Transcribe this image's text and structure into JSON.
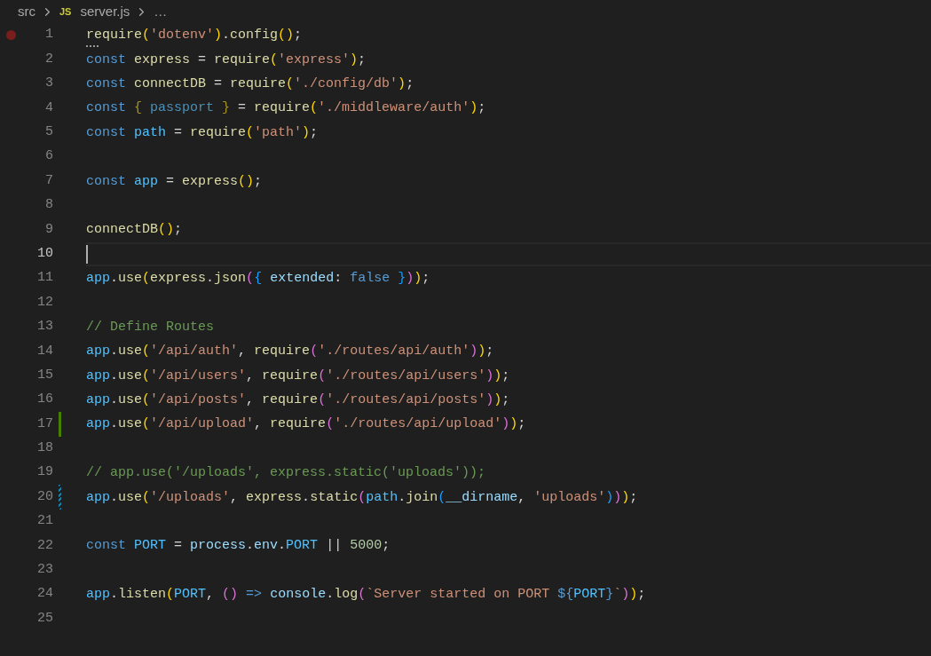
{
  "breadcrumb": [
    {
      "kind": "folder",
      "text": "src"
    },
    {
      "kind": "file",
      "text": "server.js",
      "icon_text": "JS"
    },
    {
      "kind": "more",
      "text": "…"
    }
  ],
  "lines": [
    {
      "number": "1",
      "breakpoint": true,
      "selected": false,
      "added": false,
      "modified": false,
      "hint": true,
      "tokens": [
        {
          "kind": "function",
          "text": "require"
        },
        {
          "kind": "bracket-outer",
          "text": "("
        },
        {
          "kind": "string",
          "text": "'dotenv'"
        },
        {
          "kind": "bracket-outer",
          "text": ")"
        },
        {
          "kind": "punctuation",
          "text": "."
        },
        {
          "kind": "function",
          "text": "config"
        },
        {
          "kind": "bracket-outer",
          "text": "()"
        },
        {
          "kind": "punctuation",
          "text": ";"
        }
      ]
    },
    {
      "number": "2",
      "breakpoint": false,
      "selected": false,
      "added": false,
      "modified": false,
      "hint": false,
      "tokens": [
        {
          "kind": "keyword",
          "text": "const "
        },
        {
          "kind": "function",
          "text": "express"
        },
        {
          "kind": "punctuation",
          "text": " = "
        },
        {
          "kind": "function",
          "text": "require"
        },
        {
          "kind": "bracket-outer",
          "text": "("
        },
        {
          "kind": "string",
          "text": "'express'"
        },
        {
          "kind": "bracket-outer",
          "text": ")"
        },
        {
          "kind": "punctuation",
          "text": ";"
        }
      ]
    },
    {
      "number": "3",
      "breakpoint": false,
      "selected": false,
      "added": false,
      "modified": false,
      "hint": false,
      "tokens": [
        {
          "kind": "keyword",
          "text": "const "
        },
        {
          "kind": "function",
          "text": "connectDB"
        },
        {
          "kind": "punctuation",
          "text": " = "
        },
        {
          "kind": "function",
          "text": "require"
        },
        {
          "kind": "bracket-outer",
          "text": "("
        },
        {
          "kind": "string",
          "text": "'./config/db'"
        },
        {
          "kind": "bracket-outer",
          "text": ")"
        },
        {
          "kind": "punctuation",
          "text": ";"
        }
      ]
    },
    {
      "number": "4",
      "breakpoint": false,
      "selected": false,
      "added": false,
      "modified": false,
      "hint": false,
      "tokens": [
        {
          "kind": "keyword",
          "text": "const "
        },
        {
          "kind": "unused-bracket",
          "text": "{ "
        },
        {
          "kind": "unused",
          "text": "passport "
        },
        {
          "kind": "unused-bracket",
          "text": "}"
        },
        {
          "kind": "punctuation",
          "text": " = "
        },
        {
          "kind": "function",
          "text": "require"
        },
        {
          "kind": "bracket-outer",
          "text": "("
        },
        {
          "kind": "string",
          "text": "'./middleware/auth'"
        },
        {
          "kind": "bracket-outer",
          "text": ")"
        },
        {
          "kind": "punctuation",
          "text": ";"
        }
      ]
    },
    {
      "number": "5",
      "breakpoint": false,
      "selected": false,
      "added": false,
      "modified": false,
      "hint": false,
      "tokens": [
        {
          "kind": "keyword",
          "text": "const "
        },
        {
          "kind": "constant",
          "text": "path"
        },
        {
          "kind": "punctuation",
          "text": " = "
        },
        {
          "kind": "function",
          "text": "require"
        },
        {
          "kind": "bracket-outer",
          "text": "("
        },
        {
          "kind": "string",
          "text": "'path'"
        },
        {
          "kind": "bracket-outer",
          "text": ")"
        },
        {
          "kind": "punctuation",
          "text": ";"
        }
      ]
    },
    {
      "number": "6",
      "breakpoint": false,
      "selected": false,
      "added": false,
      "modified": false,
      "hint": false
    },
    {
      "number": "7",
      "breakpoint": false,
      "selected": false,
      "added": false,
      "modified": false,
      "hint": false,
      "tokens": [
        {
          "kind": "keyword",
          "text": "const "
        },
        {
          "kind": "constant",
          "text": "app"
        },
        {
          "kind": "punctuation",
          "text": " = "
        },
        {
          "kind": "function",
          "text": "express"
        },
        {
          "kind": "bracket-outer",
          "text": "()"
        },
        {
          "kind": "punctuation",
          "text": ";"
        }
      ]
    },
    {
      "number": "8",
      "breakpoint": false,
      "selected": false,
      "added": false,
      "modified": false,
      "hint": false
    },
    {
      "number": "9",
      "breakpoint": false,
      "selected": false,
      "added": false,
      "modified": false,
      "hint": false,
      "tokens": [
        {
          "kind": "function",
          "text": "connectDB"
        },
        {
          "kind": "bracket-outer",
          "text": "()"
        },
        {
          "kind": "punctuation",
          "text": ";"
        }
      ]
    },
    {
      "number": "10",
      "breakpoint": false,
      "selected": true,
      "added": false,
      "modified": false,
      "hint": false
    },
    {
      "number": "11",
      "breakpoint": false,
      "selected": false,
      "added": false,
      "modified": false,
      "hint": false,
      "tokens": [
        {
          "kind": "constant",
          "text": "app"
        },
        {
          "kind": "punctuation",
          "text": "."
        },
        {
          "kind": "function",
          "text": "use"
        },
        {
          "kind": "bracket-outer",
          "text": "("
        },
        {
          "kind": "function",
          "text": "express"
        },
        {
          "kind": "punctuation",
          "text": "."
        },
        {
          "kind": "function",
          "text": "json"
        },
        {
          "kind": "bracket-middle",
          "text": "("
        },
        {
          "kind": "bracket-inner",
          "text": "{ "
        },
        {
          "kind": "variable",
          "text": "extended"
        },
        {
          "kind": "punctuation",
          "text": ": "
        },
        {
          "kind": "keyword",
          "text": "false "
        },
        {
          "kind": "bracket-inner",
          "text": "}"
        },
        {
          "kind": "bracket-middle",
          "text": ")"
        },
        {
          "kind": "bracket-outer",
          "text": ")"
        },
        {
          "kind": "punctuation",
          "text": ";"
        }
      ]
    },
    {
      "number": "12",
      "breakpoint": false,
      "selected": false,
      "added": false,
      "modified": false,
      "hint": false
    },
    {
      "number": "13",
      "breakpoint": false,
      "selected": false,
      "added": false,
      "modified": false,
      "hint": false,
      "tokens": [
        {
          "kind": "comment",
          "text": "// Define Routes"
        }
      ]
    },
    {
      "number": "14",
      "breakpoint": false,
      "selected": false,
      "added": false,
      "modified": false,
      "hint": false,
      "tokens": [
        {
          "kind": "constant",
          "text": "app"
        },
        {
          "kind": "punctuation",
          "text": "."
        },
        {
          "kind": "function",
          "text": "use"
        },
        {
          "kind": "bracket-outer",
          "text": "("
        },
        {
          "kind": "string",
          "text": "'/api/auth'"
        },
        {
          "kind": "punctuation",
          "text": ", "
        },
        {
          "kind": "function",
          "text": "require"
        },
        {
          "kind": "bracket-middle",
          "text": "("
        },
        {
          "kind": "string",
          "text": "'./routes/api/auth'"
        },
        {
          "kind": "bracket-middle",
          "text": ")"
        },
        {
          "kind": "bracket-outer",
          "text": ")"
        },
        {
          "kind": "punctuation",
          "text": ";"
        }
      ]
    },
    {
      "number": "15",
      "breakpoint": false,
      "selected": false,
      "added": false,
      "modified": false,
      "hint": false,
      "tokens": [
        {
          "kind": "constant",
          "text": "app"
        },
        {
          "kind": "punctuation",
          "text": "."
        },
        {
          "kind": "function",
          "text": "use"
        },
        {
          "kind": "bracket-outer",
          "text": "("
        },
        {
          "kind": "string",
          "text": "'/api/users'"
        },
        {
          "kind": "punctuation",
          "text": ", "
        },
        {
          "kind": "function",
          "text": "require"
        },
        {
          "kind": "bracket-middle",
          "text": "("
        },
        {
          "kind": "string",
          "text": "'./routes/api/users'"
        },
        {
          "kind": "bracket-middle",
          "text": ")"
        },
        {
          "kind": "bracket-outer",
          "text": ")"
        },
        {
          "kind": "punctuation",
          "text": ";"
        }
      ]
    },
    {
      "number": "16",
      "breakpoint": false,
      "selected": false,
      "added": false,
      "modified": false,
      "hint": false,
      "tokens": [
        {
          "kind": "constant",
          "text": "app"
        },
        {
          "kind": "punctuation",
          "text": "."
        },
        {
          "kind": "function",
          "text": "use"
        },
        {
          "kind": "bracket-outer",
          "text": "("
        },
        {
          "kind": "string",
          "text": "'/api/posts'"
        },
        {
          "kind": "punctuation",
          "text": ", "
        },
        {
          "kind": "function",
          "text": "require"
        },
        {
          "kind": "bracket-middle",
          "text": "("
        },
        {
          "kind": "string",
          "text": "'./routes/api/posts'"
        },
        {
          "kind": "bracket-middle",
          "text": ")"
        },
        {
          "kind": "bracket-outer",
          "text": ")"
        },
        {
          "kind": "punctuation",
          "text": ";"
        }
      ]
    },
    {
      "number": "17",
      "breakpoint": false,
      "selected": false,
      "added": true,
      "modified": false,
      "hint": false,
      "tokens": [
        {
          "kind": "constant",
          "text": "app"
        },
        {
          "kind": "punctuation",
          "text": "."
        },
        {
          "kind": "function",
          "text": "use"
        },
        {
          "kind": "bracket-outer",
          "text": "("
        },
        {
          "kind": "string",
          "text": "'/api/upload'"
        },
        {
          "kind": "punctuation",
          "text": ", "
        },
        {
          "kind": "function",
          "text": "require"
        },
        {
          "kind": "bracket-middle",
          "text": "("
        },
        {
          "kind": "string",
          "text": "'./routes/api/upload'"
        },
        {
          "kind": "bracket-middle",
          "text": ")"
        },
        {
          "kind": "bracket-outer",
          "text": ")"
        },
        {
          "kind": "punctuation",
          "text": ";"
        }
      ]
    },
    {
      "number": "18",
      "breakpoint": false,
      "selected": false,
      "added": false,
      "modified": false,
      "hint": false
    },
    {
      "number": "19",
      "breakpoint": false,
      "selected": false,
      "added": false,
      "modified": false,
      "hint": false,
      "tokens": [
        {
          "kind": "comment",
          "text": "// app.use('/uploads', express.static('uploads'));"
        }
      ]
    },
    {
      "number": "20",
      "breakpoint": false,
      "selected": false,
      "added": false,
      "modified": true,
      "hint": false,
      "tokens": [
        {
          "kind": "constant",
          "text": "app"
        },
        {
          "kind": "punctuation",
          "text": "."
        },
        {
          "kind": "function",
          "text": "use"
        },
        {
          "kind": "bracket-outer",
          "text": "("
        },
        {
          "kind": "string",
          "text": "'/uploads'"
        },
        {
          "kind": "punctuation",
          "text": ", "
        },
        {
          "kind": "function",
          "text": "express"
        },
        {
          "kind": "punctuation",
          "text": "."
        },
        {
          "kind": "function",
          "text": "static"
        },
        {
          "kind": "bracket-middle",
          "text": "("
        },
        {
          "kind": "constant",
          "text": "path"
        },
        {
          "kind": "punctuation",
          "text": "."
        },
        {
          "kind": "function",
          "text": "join"
        },
        {
          "kind": "bracket-inner",
          "text": "("
        },
        {
          "kind": "variable",
          "text": "__dirname"
        },
        {
          "kind": "punctuation",
          "text": ", "
        },
        {
          "kind": "string",
          "text": "'uploads'"
        },
        {
          "kind": "bracket-inner",
          "text": ")"
        },
        {
          "kind": "bracket-middle",
          "text": ")"
        },
        {
          "kind": "bracket-outer",
          "text": ")"
        },
        {
          "kind": "punctuation",
          "text": ";"
        }
      ]
    },
    {
      "number": "21",
      "breakpoint": false,
      "selected": false,
      "added": false,
      "modified": false,
      "hint": false
    },
    {
      "number": "22",
      "breakpoint": false,
      "selected": false,
      "added": false,
      "modified": false,
      "hint": false,
      "tokens": [
        {
          "kind": "keyword",
          "text": "const "
        },
        {
          "kind": "constant",
          "text": "PORT"
        },
        {
          "kind": "punctuation",
          "text": " = "
        },
        {
          "kind": "variable",
          "text": "process"
        },
        {
          "kind": "punctuation",
          "text": "."
        },
        {
          "kind": "variable",
          "text": "env"
        },
        {
          "kind": "punctuation",
          "text": "."
        },
        {
          "kind": "constant",
          "text": "PORT"
        },
        {
          "kind": "punctuation",
          "text": " || "
        },
        {
          "kind": "number",
          "text": "5000"
        },
        {
          "kind": "punctuation",
          "text": ";"
        }
      ]
    },
    {
      "number": "23",
      "breakpoint": false,
      "selected": false,
      "added": false,
      "modified": false,
      "hint": false
    },
    {
      "number": "24",
      "breakpoint": false,
      "selected": false,
      "added": false,
      "modified": false,
      "hint": false,
      "tokens": [
        {
          "kind": "constant",
          "text": "app"
        },
        {
          "kind": "punctuation",
          "text": "."
        },
        {
          "kind": "function",
          "text": "listen"
        },
        {
          "kind": "bracket-outer",
          "text": "("
        },
        {
          "kind": "constant",
          "text": "PORT"
        },
        {
          "kind": "punctuation",
          "text": ", "
        },
        {
          "kind": "bracket-middle",
          "text": "() "
        },
        {
          "kind": "keyword",
          "text": "=> "
        },
        {
          "kind": "variable",
          "text": "console"
        },
        {
          "kind": "punctuation",
          "text": "."
        },
        {
          "kind": "function",
          "text": "log"
        },
        {
          "kind": "bracket-middle",
          "text": "("
        },
        {
          "kind": "string",
          "text": "`Server started on PORT "
        },
        {
          "kind": "keyword",
          "text": "${"
        },
        {
          "kind": "constant",
          "text": "PORT"
        },
        {
          "kind": "keyword",
          "text": "}"
        },
        {
          "kind": "string",
          "text": "`"
        },
        {
          "kind": "bracket-middle",
          "text": ")"
        },
        {
          "kind": "bracket-outer",
          "text": ")"
        },
        {
          "kind": "punctuation",
          "text": ";"
        }
      ]
    },
    {
      "number": "25",
      "breakpoint": false,
      "selected": false,
      "added": false,
      "modified": false,
      "hint": false
    }
  ]
}
